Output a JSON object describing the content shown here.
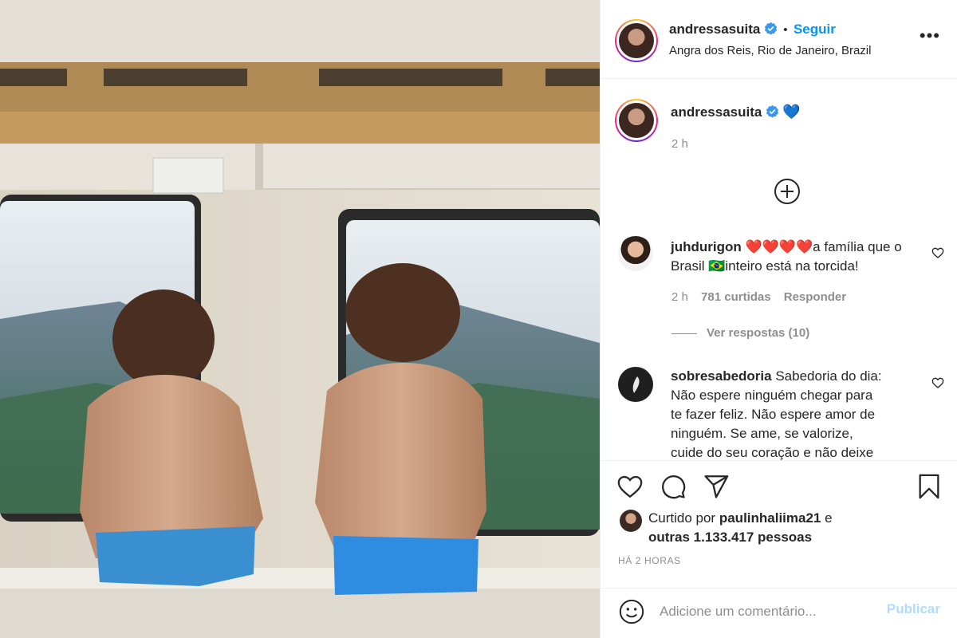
{
  "post": {
    "username": "andressasuita",
    "follow_label": "Seguir",
    "separator": "•",
    "location": "Angra dos Reis, Rio de Janeiro, Brazil",
    "caption_emoji": "💙",
    "caption_time": "2 h"
  },
  "comments": [
    {
      "username": "juhdurigon",
      "text_a": "❤️❤️❤️❤️a família que o",
      "text_b": "Brasil 🇧🇷inteiro está na torcida!",
      "time": "2 h",
      "likes": "781 curtidas",
      "reply": "Responder",
      "view_replies": "Ver respostas (10)"
    },
    {
      "username": "sobresabedoria",
      "lines": [
        "Sabedoria do dia:",
        "Não espere ninguém chegar para",
        "te fazer feliz. Não espere amor de",
        "ninguém. Se ame, se valorize,",
        "cuide do seu coração e não deixe"
      ]
    }
  ],
  "likes": {
    "prefix": "Curtido por",
    "user": "paulinhaliima21",
    "conj": "e",
    "others": "outras 1.133.417 pessoas"
  },
  "timestamp": "HÁ 2 HORAS",
  "add_comment": {
    "placeholder": "Adicione um comentário...",
    "publish": "Publicar"
  },
  "icons": [
    "more-options-icon",
    "verified-icon",
    "plus-circle-icon",
    "heart-icon",
    "comment-icon",
    "share-icon",
    "bookmark-icon",
    "emoji-icon"
  ],
  "colors": {
    "accent": "#0095f6",
    "publish_disabled": "#b3dbff",
    "muted": "#8e8e8e",
    "verified": "#3897f0"
  }
}
